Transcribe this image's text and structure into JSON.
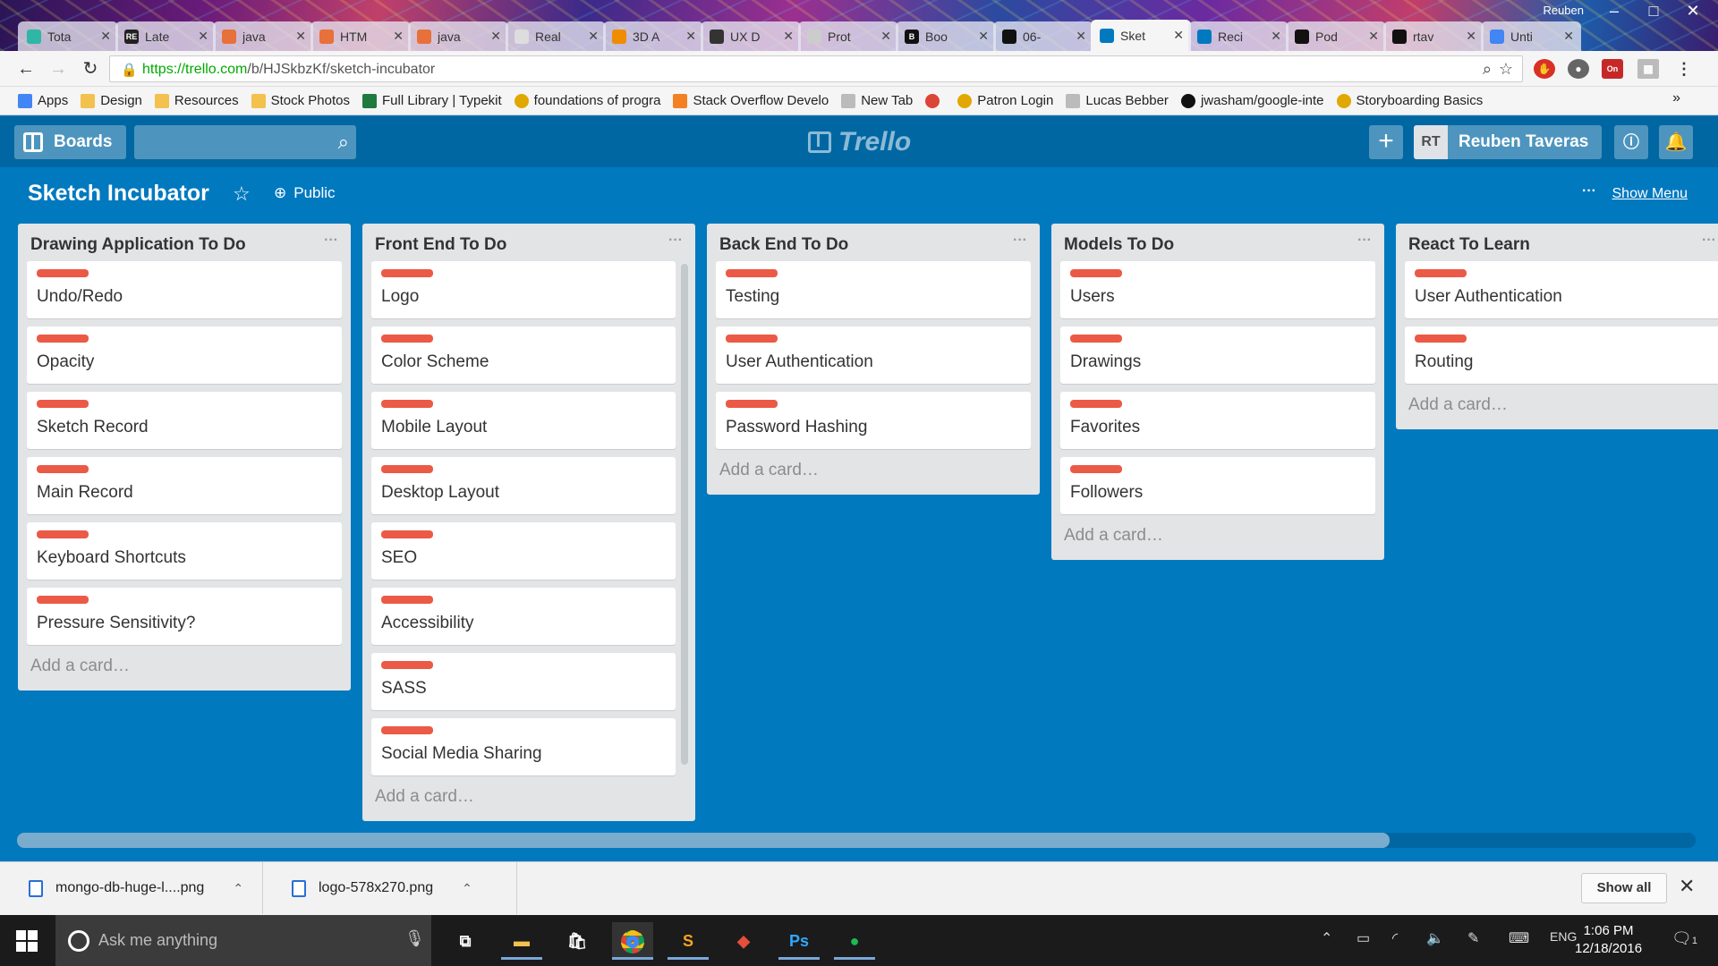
{
  "browser": {
    "tabs": [
      {
        "title": "Tota",
        "color": "#2fb6a4"
      },
      {
        "title": "Late",
        "color": "#222222",
        "badge": "RE"
      },
      {
        "title": "java",
        "color": "#e8703a"
      },
      {
        "title": "HTM",
        "color": "#e8703a"
      },
      {
        "title": "java",
        "color": "#e8703a"
      },
      {
        "title": "Real",
        "color": "#dddddd"
      },
      {
        "title": "3D A",
        "color": "#f08c00"
      },
      {
        "title": "UX D",
        "color": "#333333"
      },
      {
        "title": "Prot",
        "color": "#cccccc"
      },
      {
        "title": "Boo",
        "color": "#111111",
        "badge": "B"
      },
      {
        "title": "06-",
        "color": "#111111"
      },
      {
        "title": "Sket",
        "color": "#0079bf",
        "active": true
      },
      {
        "title": "Reci",
        "color": "#0079bf"
      },
      {
        "title": "Pod",
        "color": "#111111"
      },
      {
        "title": "rtav",
        "color": "#111111"
      },
      {
        "title": "Unti",
        "color": "#4285f4"
      }
    ],
    "window_user": "Reuben",
    "url_host": "https://trello.com",
    "url_path": "/b/HJSkbzKf/sketch-incubator",
    "bookmarks": [
      {
        "label": "Apps",
        "kind": "apps"
      },
      {
        "label": "Design",
        "kind": "folder"
      },
      {
        "label": "Resources",
        "kind": "folder"
      },
      {
        "label": "Stock Photos",
        "kind": "folder"
      },
      {
        "label": "Full Library | Typekit",
        "kind": "typekit"
      },
      {
        "label": "foundations of progra",
        "kind": "site"
      },
      {
        "label": "Stack Overflow Develo",
        "kind": "so"
      },
      {
        "label": "New Tab",
        "kind": "page"
      },
      {
        "label": "",
        "kind": "google"
      },
      {
        "label": "Patron Login",
        "kind": "site"
      },
      {
        "label": "Lucas Bebber",
        "kind": "page"
      },
      {
        "label": "jwasham/google-inte",
        "kind": "github"
      },
      {
        "label": "Storyboarding Basics",
        "kind": "site"
      }
    ],
    "bookmarks_more": "»"
  },
  "trello": {
    "boards_label": "Boards",
    "logo_text": "Trello",
    "avatar_initials": "RT",
    "member_name": "Reuben Taveras",
    "board_title": "Sketch Incubator",
    "visibility": "Public",
    "show_menu": "Show Menu",
    "lists": [
      {
        "title": "Drawing Application To Do",
        "cards": [
          "Undo/Redo",
          "Opacity",
          "Sketch Record",
          "Main Record",
          "Keyboard Shortcuts",
          "Pressure Sensitivity?"
        ],
        "add_card": "Add a card…"
      },
      {
        "title": "Front End To Do",
        "cards": [
          "Logo",
          "Color Scheme",
          "Mobile Layout",
          "Desktop Layout",
          "SEO",
          "Accessibility",
          "SASS",
          "Social Media Sharing"
        ],
        "add_card": "Add a card…"
      },
      {
        "title": "Back End To Do",
        "cards": [
          "Testing",
          "User Authentication",
          "Password Hashing"
        ],
        "add_card": "Add a card…"
      },
      {
        "title": "Models To Do",
        "cards": [
          "Users",
          "Drawings",
          "Favorites",
          "Followers"
        ],
        "add_card": "Add a card…"
      },
      {
        "title": "React To Learn",
        "cards": [
          "User Authentication",
          "Routing"
        ],
        "add_card": "Add a card…"
      }
    ],
    "label_color": "#eb5a46",
    "board_color": "#0079bf"
  },
  "downloads": {
    "items": [
      "mongo-db-huge-l....png",
      "logo-578x270.png"
    ],
    "show_all": "Show all"
  },
  "taskbar": {
    "search_placeholder": "Ask me anything",
    "language": "ENG",
    "time": "1:06 PM",
    "date": "12/18/2016",
    "notification_count": "1"
  }
}
